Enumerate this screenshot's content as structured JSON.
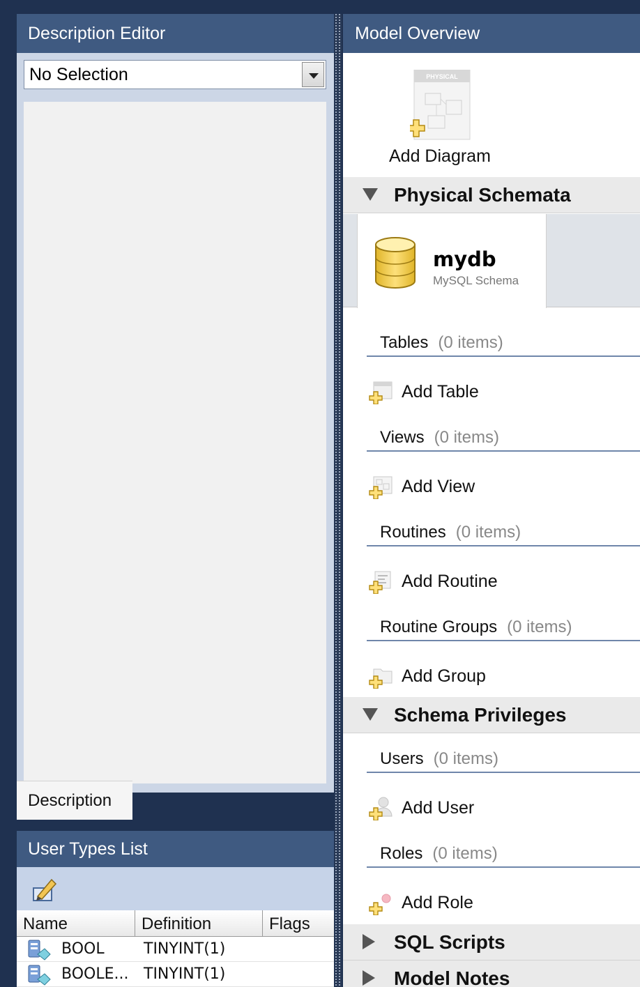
{
  "description_editor": {
    "title": "Description Editor",
    "selection": "No Selection",
    "tab_label": "Description"
  },
  "user_types": {
    "title": "User Types List",
    "columns": [
      "Name",
      "Definition",
      "Flags"
    ],
    "rows": [
      {
        "name": "BOOL",
        "definition": "TINYINT(1)",
        "flags": ""
      },
      {
        "name": "BOOLE...",
        "definition": "TINYINT(1)",
        "flags": ""
      }
    ]
  },
  "model_overview": {
    "title": "Model Overview",
    "add_diagram_label": "Add Diagram",
    "diagram_thumb_label": "PHYSICAL",
    "physical_schemata": {
      "title": "Physical Schemata",
      "schema": {
        "name": "mydb",
        "type": "MySQL Schema"
      },
      "groups": [
        {
          "title": "Tables",
          "count": "(0 items)",
          "add_label": "Add Table",
          "icon": "add-table-icon"
        },
        {
          "title": "Views",
          "count": "(0 items)",
          "add_label": "Add View",
          "icon": "add-view-icon"
        },
        {
          "title": "Routines",
          "count": "(0 items)",
          "add_label": "Add Routine",
          "icon": "add-routine-icon"
        },
        {
          "title": "Routine Groups",
          "count": "(0 items)",
          "add_label": "Add Group",
          "icon": "add-group-icon"
        }
      ]
    },
    "schema_privileges": {
      "title": "Schema Privileges",
      "groups": [
        {
          "title": "Users",
          "count": "(0 items)",
          "add_label": "Add User",
          "icon": "add-user-icon"
        },
        {
          "title": "Roles",
          "count": "(0 items)",
          "add_label": "Add Role",
          "icon": "add-role-icon"
        }
      ]
    },
    "sql_scripts": {
      "title": "SQL Scripts"
    },
    "model_notes": {
      "title": "Model Notes"
    }
  },
  "colors": {
    "panel_header": "#3f5a81",
    "background": "#1f3150",
    "section_header": "#eaeaea",
    "group_underline": "#6f86aa"
  }
}
